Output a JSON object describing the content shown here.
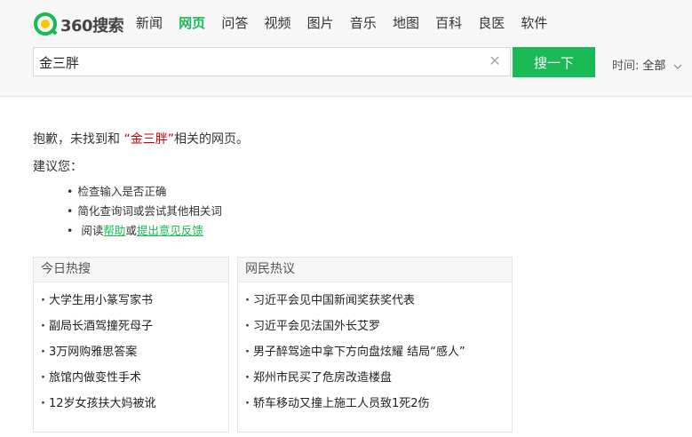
{
  "logo": {
    "text": "360搜索",
    "colors": {
      "ring": "#19b955",
      "dot": "#f7c800"
    }
  },
  "nav": [
    {
      "label": "新闻"
    },
    {
      "label": "网页",
      "active": true
    },
    {
      "label": "问答"
    },
    {
      "label": "视频"
    },
    {
      "label": "图片"
    },
    {
      "label": "音乐"
    },
    {
      "label": "地图"
    },
    {
      "label": "百科"
    },
    {
      "label": "良医"
    },
    {
      "label": "软件"
    }
  ],
  "search": {
    "value": "金三胖",
    "button_label": "搜一下"
  },
  "time_filter": {
    "label": "时间:",
    "value": "全部"
  },
  "message": {
    "prefix": "抱歉，未找到和 ",
    "query": "“金三胖”",
    "suffix": "相关的网页。",
    "suggest_title": "建议您：",
    "suggestions": {
      "check_input": "检查输入是否正确",
      "simplify": "简化查询词或尝试其他相关词",
      "read_prefix": "阅读",
      "help_link": "帮助",
      "or": "或",
      "feedback_link": "提出意见反馈"
    }
  },
  "today_hot": {
    "title": "今日热搜",
    "items": [
      "大学生用小篆写家书",
      "副局长酒驾撞死母子",
      "3万网购雅思答案",
      "旅馆内做变性手术",
      "12岁女孩扶大妈被讹"
    ]
  },
  "netizen_hot": {
    "title": "网民热议",
    "items": [
      "习近平会见中国新闻奖获奖代表",
      "习近平会见法国外长艾罗",
      "男子醉驾途中拿下方向盘炫耀 结局“感人”",
      "郑州市民买了危房改造楼盘",
      "轿车移动又撞上施工人员致1死2伤"
    ]
  },
  "accent_color": "#19b955"
}
